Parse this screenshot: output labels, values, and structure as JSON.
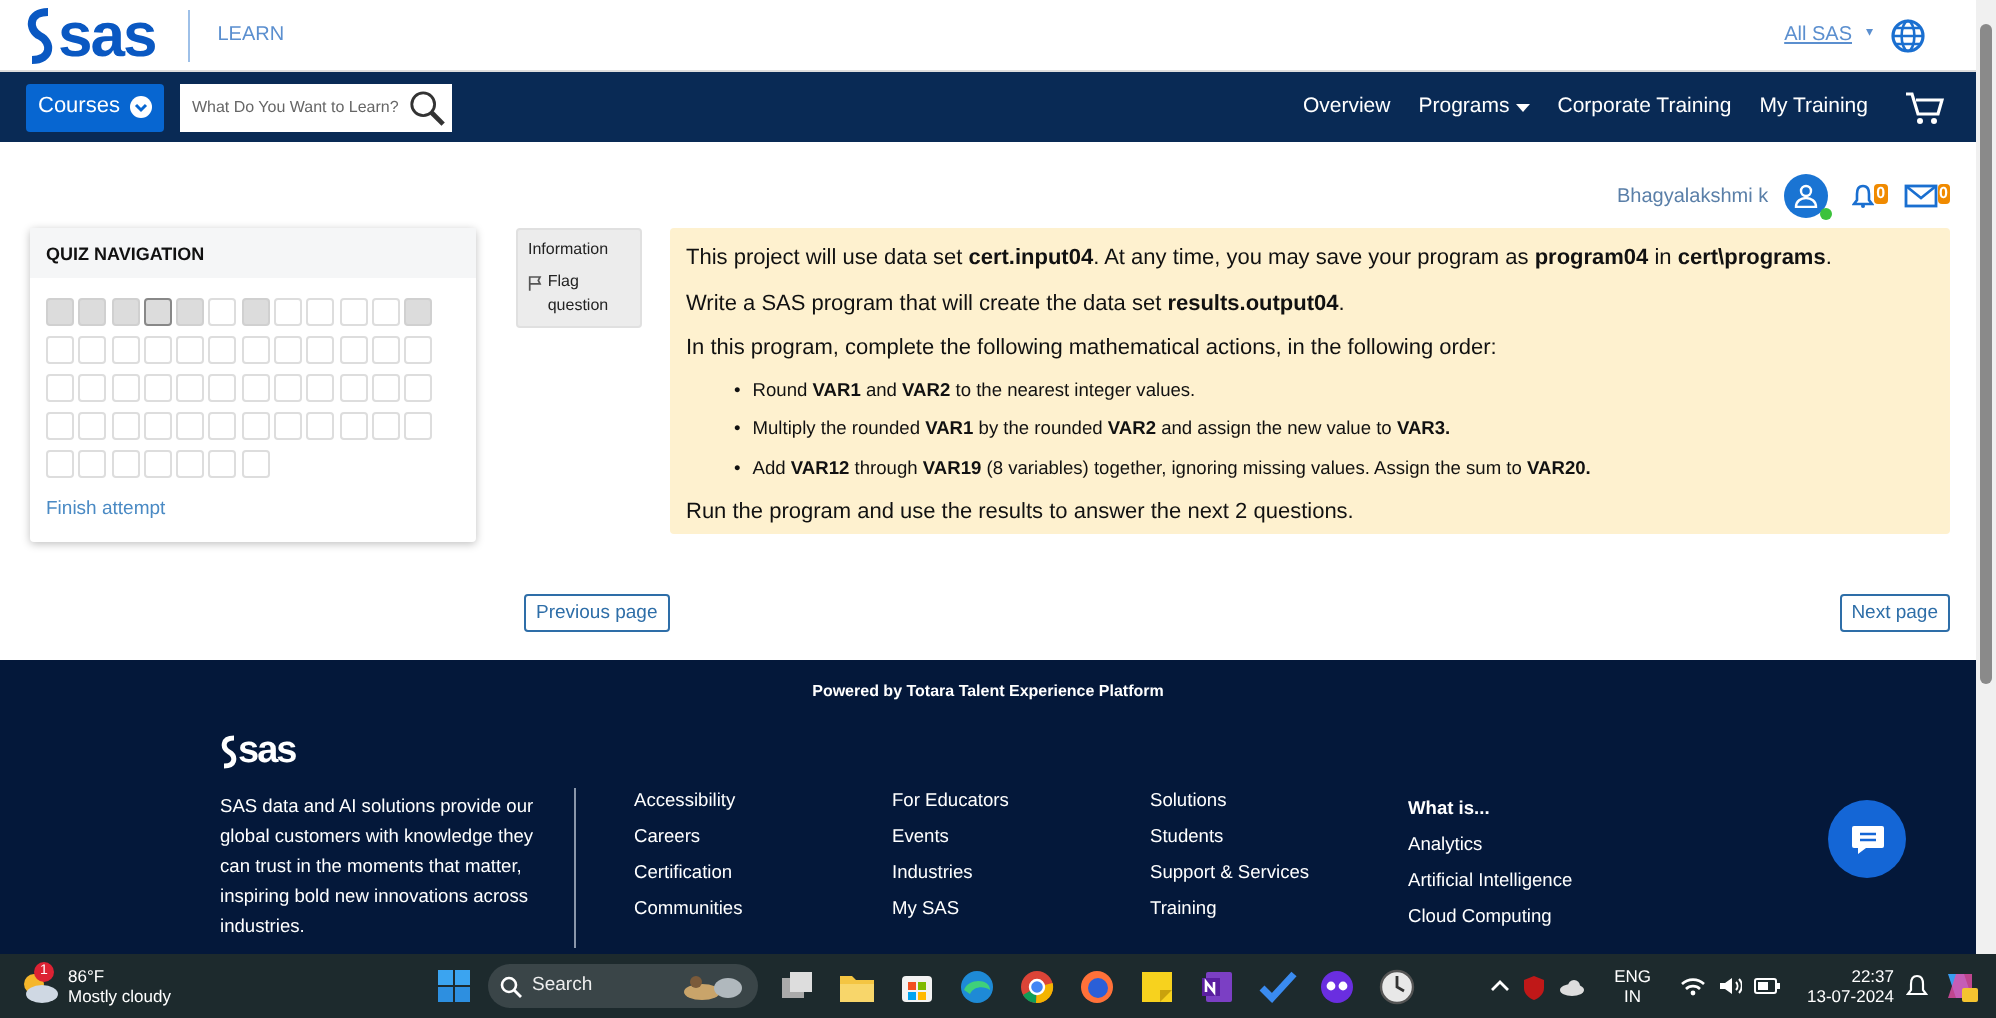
{
  "header": {
    "logo": "sas",
    "section": "LEARN",
    "region_menu": "All SAS",
    "region_caret": "▾"
  },
  "nav": {
    "courses_button": "Courses",
    "search": {
      "placeholder": "What Do You Want to Learn?"
    },
    "links": [
      {
        "label": "Overview",
        "dropdown": false
      },
      {
        "label": "Programs",
        "dropdown": true
      },
      {
        "label": "Corporate Training",
        "dropdown": false
      },
      {
        "label": "My Training",
        "dropdown": false
      }
    ]
  },
  "user": {
    "name": "Bhagyalakshmi k",
    "online": true,
    "notifications": "0",
    "messages": "0"
  },
  "quiz_navigation": {
    "title": "QUIZ NAVIGATION",
    "finish": "Finish attempt",
    "cells": [
      {
        "answered": true,
        "selected": false
      },
      {
        "answered": true,
        "selected": false
      },
      {
        "answered": true,
        "selected": false
      },
      {
        "answered": true,
        "selected": true
      },
      {
        "answered": true,
        "selected": false
      },
      {
        "answered": false,
        "selected": false
      },
      {
        "answered": true,
        "selected": false
      },
      {
        "answered": false,
        "selected": false
      },
      {
        "answered": false,
        "selected": false
      },
      {
        "answered": false,
        "selected": false
      },
      {
        "answered": false,
        "selected": false
      },
      {
        "answered": true,
        "selected": false
      },
      {
        "answered": false,
        "selected": false
      },
      {
        "answered": false,
        "selected": false
      },
      {
        "answered": false,
        "selected": false
      },
      {
        "answered": false,
        "selected": false
      },
      {
        "answered": false,
        "selected": false
      },
      {
        "answered": false,
        "selected": false
      },
      {
        "answered": false,
        "selected": false
      },
      {
        "answered": false,
        "selected": false
      },
      {
        "answered": false,
        "selected": false
      },
      {
        "answered": false,
        "selected": false
      },
      {
        "answered": false,
        "selected": false
      },
      {
        "answered": false,
        "selected": false
      },
      {
        "answered": false,
        "selected": false
      },
      {
        "answered": false,
        "selected": false
      },
      {
        "answered": false,
        "selected": false
      },
      {
        "answered": false,
        "selected": false
      },
      {
        "answered": false,
        "selected": false
      },
      {
        "answered": false,
        "selected": false
      },
      {
        "answered": false,
        "selected": false
      },
      {
        "answered": false,
        "selected": false
      },
      {
        "answered": false,
        "selected": false
      },
      {
        "answered": false,
        "selected": false
      },
      {
        "answered": false,
        "selected": false
      },
      {
        "answered": false,
        "selected": false
      },
      {
        "answered": false,
        "selected": false
      },
      {
        "answered": false,
        "selected": false
      },
      {
        "answered": false,
        "selected": false
      },
      {
        "answered": false,
        "selected": false
      },
      {
        "answered": false,
        "selected": false
      },
      {
        "answered": false,
        "selected": false
      },
      {
        "answered": false,
        "selected": false
      },
      {
        "answered": false,
        "selected": false
      },
      {
        "answered": false,
        "selected": false
      },
      {
        "answered": false,
        "selected": false
      },
      {
        "answered": false,
        "selected": false
      },
      {
        "answered": false,
        "selected": false
      },
      {
        "answered": false,
        "selected": false
      },
      {
        "answered": false,
        "selected": false
      },
      {
        "answered": false,
        "selected": false
      },
      {
        "answered": false,
        "selected": false
      },
      {
        "answered": false,
        "selected": false
      },
      {
        "answered": false,
        "selected": false
      },
      {
        "answered": false,
        "selected": false
      }
    ]
  },
  "info": {
    "title": "Information",
    "flag": "Flag question"
  },
  "question": {
    "intro": [
      "This project will use data set **cert.input04**. At any time, you may save your program as **program04** in **cert\\programs**.",
      "Write a SAS program that will create the data set **results.output04**.",
      "In this program, complete the following mathematical actions, in the following order:"
    ],
    "bullets": [
      {
        "marker": "•",
        "text": "Round **VAR1** and **VAR2** to the nearest integer values."
      },
      {
        "marker": "•",
        "text": "Multiply the rounded **VAR1** by the rounded **VAR2** and assign the new value to **VAR3.**"
      },
      {
        "marker": "•",
        "text": "Add **VAR12** through **VAR19** (8 variables) together, ignoring missing values. Assign the sum to **VAR20.**"
      }
    ],
    "outro": [
      "Run the program and use the results to answer the next 2 questions."
    ]
  },
  "pager": {
    "previous": "Previous page",
    "next": "Next page"
  },
  "footer": {
    "powered": "Powered by Totara Talent Experience Platform",
    "logo": "sas",
    "description": "SAS data and AI solutions provide our global customers with knowledge they can trust in the moments that matter, inspiring bold new innovations across industries.",
    "columns": [
      [
        "Accessibility",
        "Careers",
        "Certification",
        "Communities"
      ],
      [
        "For Educators",
        "Events",
        "Industries",
        "My SAS"
      ],
      [
        "Solutions",
        "Students",
        "Support & Services",
        "Training"
      ]
    ],
    "what_is": {
      "heading": "What is...",
      "items": [
        "Analytics",
        "Artificial Intelligence",
        "Cloud Computing"
      ]
    }
  },
  "taskbar": {
    "weather_badge": "1",
    "temperature": "86°F",
    "condition": "Mostly cloudy",
    "search": "Search",
    "language": "ENG",
    "region": "IN",
    "time": "22:37",
    "date": "13-07-2024"
  }
}
